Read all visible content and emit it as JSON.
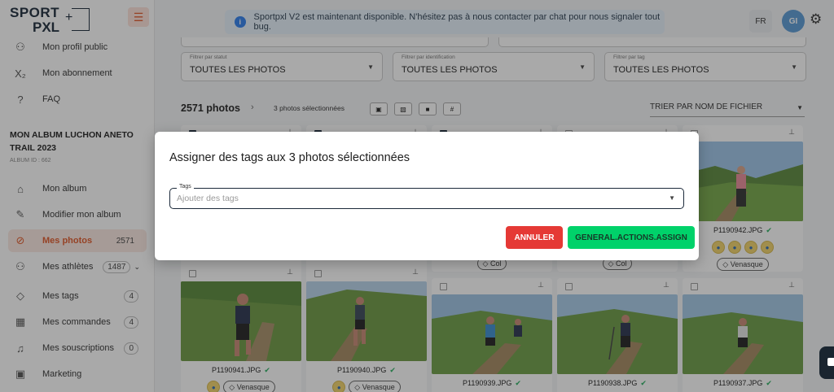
{
  "sidebar": {
    "logo_sport": "SPORT",
    "logo_pxl": "PXL",
    "items_top": [
      {
        "label": "Mon profil public",
        "icon": "person-icon"
      },
      {
        "label": "Mon abonnement",
        "icon": "subscript-icon"
      },
      {
        "label": "FAQ",
        "icon": "question-icon"
      }
    ],
    "album_title": "MON ALBUM LUCHON ANETO TRAIL 2023",
    "album_id": "ALBUM ID : 662",
    "items": [
      {
        "label": "Mon album",
        "icon": "home-icon"
      },
      {
        "label": "Modifier mon album",
        "icon": "edit-icon"
      },
      {
        "label": "Mes photos",
        "icon": "photo-icon",
        "badge": "2571"
      },
      {
        "label": "Mes athlètes",
        "icon": "people-icon",
        "badge": "1487"
      },
      {
        "label": "Mes tags",
        "icon": "tag-icon",
        "badge": "4"
      },
      {
        "label": "Mes commandes",
        "icon": "cart-icon",
        "badge": "4"
      },
      {
        "label": "Mes souscriptions",
        "icon": "bell-icon",
        "badge": "0"
      },
      {
        "label": "Marketing",
        "icon": "marketing-icon"
      }
    ]
  },
  "banner": {
    "text": "Sportpxl V2 est maintenant disponible. N'hésitez pas à nous contacter par chat pour nous signaler tout bug."
  },
  "header": {
    "lang": "FR",
    "avatar": "GI"
  },
  "filters": [
    {
      "caption": "Filtrer par statut",
      "value": "TOUTES LES PHOTOS"
    },
    {
      "caption": "Filtrer par identification",
      "value": "TOUTES LES PHOTOS"
    },
    {
      "caption": "Filtrer par tag",
      "value": "TOUTES LES PHOTOS"
    }
  ],
  "toolbar": {
    "count": "2571 photos",
    "selected": "3 photos sélectionnées",
    "sort": "TRIER PAR NOM DE FICHIER"
  },
  "photos_row2": [
    {
      "name": "P1190941.JPG",
      "tag": "Venasque"
    },
    {
      "name": "P1190940.JPG",
      "tag": "Venasque"
    },
    {
      "name": "P1190939.JPG",
      "tag": ""
    },
    {
      "name": "P1190938.JPG",
      "tag": ""
    },
    {
      "name": "P1190937.JPG",
      "tag": ""
    }
  ],
  "photos_row1": {
    "card3_tag": "Col",
    "card4_tag": "Col",
    "card5_name": "P1190942.JPG",
    "card5_tag": "Venasque"
  },
  "modal": {
    "title": "Assigner des tags aux 3 photos sélectionnées",
    "field_label": "Tags",
    "field_placeholder": "Ajouter des tags",
    "cancel": "ANNULER",
    "assign": "GENERAL.ACTIONS.ASSIGN"
  },
  "colors": {
    "accent": "#e05a2b",
    "cancel": "#e53935",
    "assign": "#00d26a"
  }
}
